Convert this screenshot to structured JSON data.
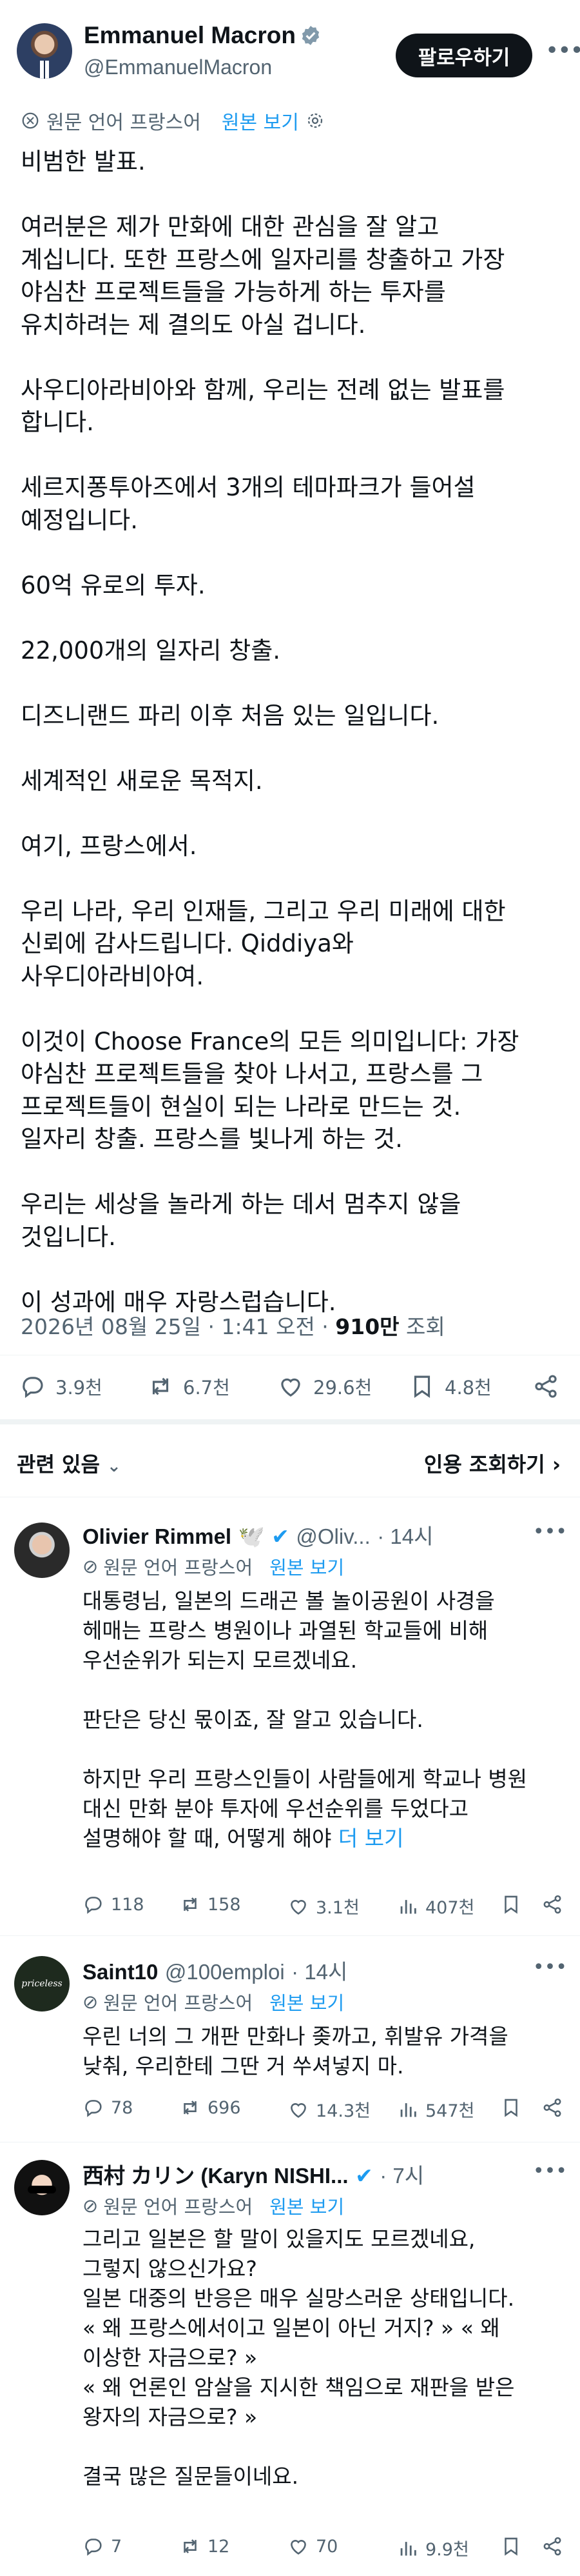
{
  "author": {
    "name": "Emmanuel Macron",
    "handle": "@EmmanuelMacron",
    "follow_label": "팔로우하기"
  },
  "translation": {
    "label": "원문 언어 프랑스어",
    "show_original": "원본 보기"
  },
  "tweet": {
    "text": "비범한 발표.\n\n여러분은 제가 만화에 대한 관심을 잘 알고\n계십니다. 또한 프랑스에 일자리를 창출하고 가장\n야심찬 프로젝트들을 가능하게 하는 투자를\n유치하려는 제 결의도 아실 겁니다.\n\n사우디아라비아와 함께, 우리는 전례 없는 발표를\n합니다.\n\n세르지퐁투아즈에서 3개의 테마파크가 들어설\n예정입니다.\n\n60억 유로의 투자.\n\n22,000개의 일자리 창출.\n\n디즈니랜드 파리 이후 처음 있는 일입니다.\n\n세계적인 새로운 목적지.\n\n여기, 프랑스에서.\n\n우리 나라, 우리 인재들, 그리고 우리 미래에 대한\n신뢰에 감사드립니다. Qiddiya와\n사우디아라비아여.\n\n이것이 Choose France의 모든 의미입니다: 가장\n야심찬 프로젝트들을 찾아 나서고, 프랑스를 그\n프로젝트들이 현실이 되는 나라로 만드는 것.\n일자리 창출. 프랑스를 빛나게 하는 것.\n\n우리는 세상을 놀라게 하는 데서 멈추지 않을\n것입니다.\n\n이 성과에 매우 자랑스럽습니다.",
    "date": "2026년 08월 25일 · 1:41 오전 · ",
    "views_count": "910만",
    "views_label": " 조회"
  },
  "actions": {
    "replies": "3.9천",
    "reposts": "6.7천",
    "likes": "29.6천",
    "bookmarks": "4.8천"
  },
  "related": {
    "left": "관련 있음",
    "right": "인용 조회하기"
  },
  "replies": [
    {
      "name": "Olivier Rimmel",
      "handle": "@Oliv...",
      "time": "· 14시",
      "body": "대통령님, 일본의 드래곤 볼 놀이공원이 사경을\n헤매는 프랑스 병원이나 과열된 학교들에 비해\n우선순위가 되는지 모르겠네요.\n\n판단은 당신 몫이죠, 잘 알고 있습니다.\n\n하지만 우리 프랑스인들이 사람들에게 학교나 병원\n대신 만화 분야 투자에 우선순위를 두었다고\n설명해야 할 때, 어떻게 해야 ",
      "more": "더 보기",
      "replies": "118",
      "reposts": "158",
      "likes": "3.1천",
      "views": "407천"
    },
    {
      "name": "Saint10",
      "handle": "@100emploi",
      "time": "· 14시",
      "body": "우린 너의 그 개판 만화나 좆까고, 휘발유 가격을\n낮춰, 우리한테 그딴 거 쑤셔넣지 마.",
      "replies": "78",
      "reposts": "696",
      "likes": "14.3천",
      "views": "547천"
    },
    {
      "name": "西村 カリン (Karyn NISHI...",
      "handle": "",
      "time": "· 7시",
      "body": "그리고 일본은 할 말이 있을지도 모르겠네요,\n그렇지 않으신가요?\n일본 대중의 반응은 매우 실망스러운 상태입니다.\n« 왜 프랑스에서이고 일본이 아닌 거지? » « 왜\n이상한 자금으로? »\n« 왜 언론인 암살을 지시한 책임으로 재판을 받은\n왕자의 자금으로? »\n\n결국 많은 질문들이네요.",
      "replies": "7",
      "reposts": "12",
      "likes": "70",
      "views": "9.9천"
    }
  ],
  "saint10_avatar_text": "priceless",
  "colors": {
    "accent": "#1d9bf0",
    "muted": "#536471",
    "text": "#0f1419"
  }
}
